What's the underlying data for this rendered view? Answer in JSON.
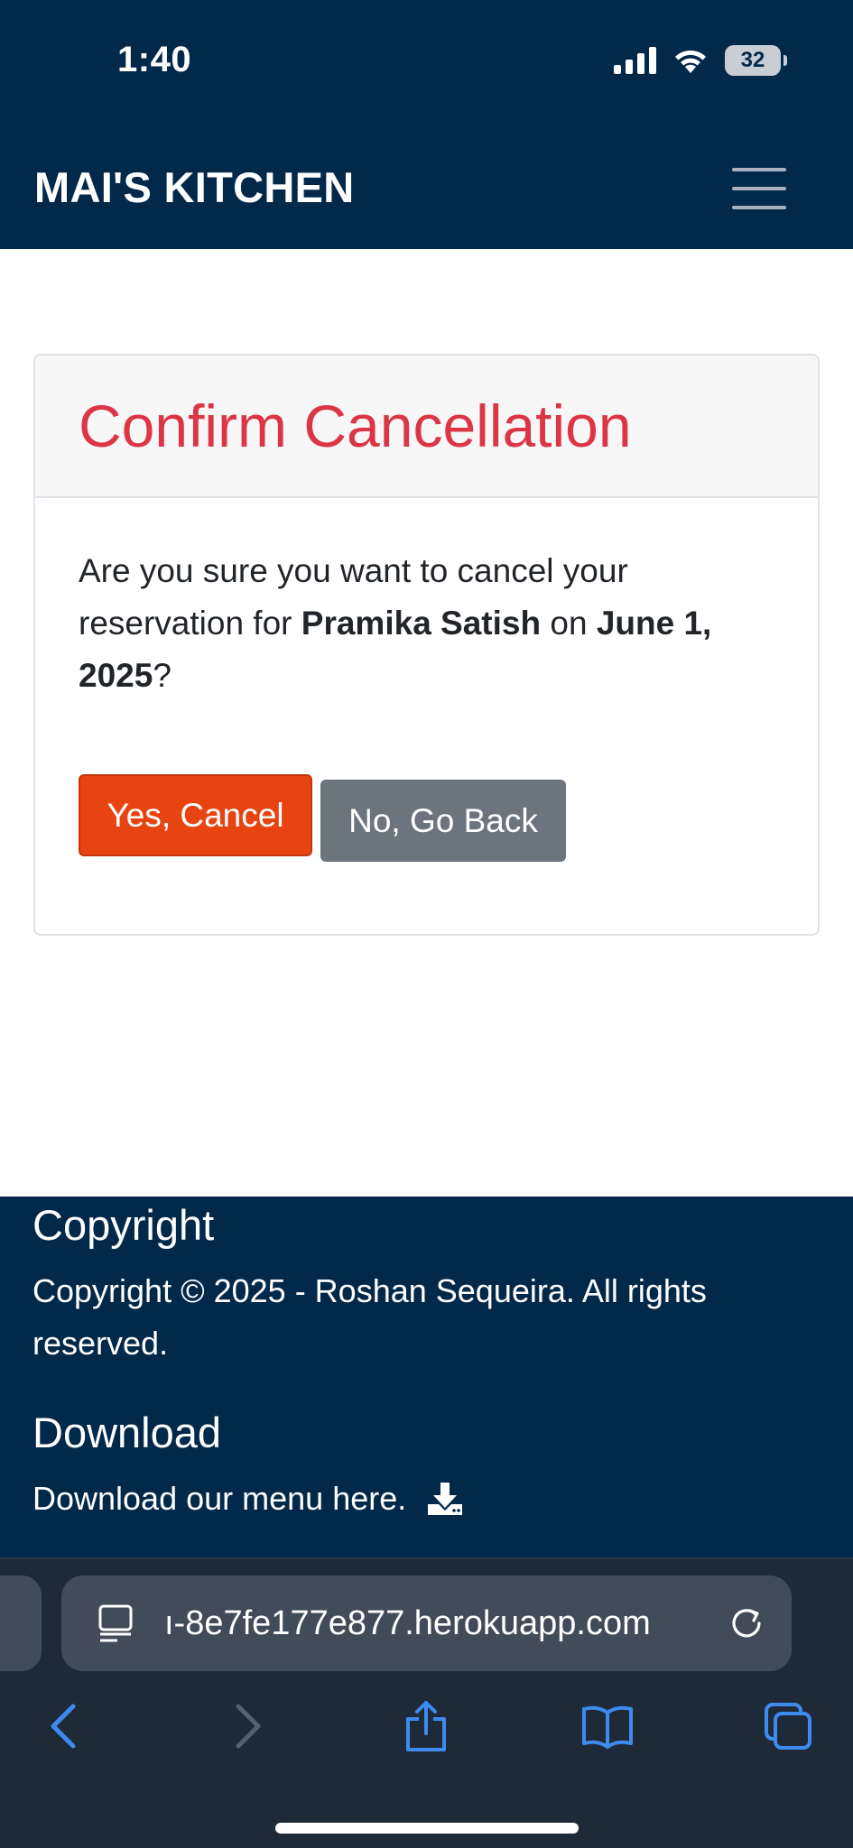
{
  "status_bar": {
    "time": "1:40",
    "battery": "32"
  },
  "navbar": {
    "brand": "MAI'S KITCHEN"
  },
  "card": {
    "title": "Confirm Cancellation",
    "text_before": "Are you sure you want to cancel your reservation for ",
    "name": "Pramika Satish",
    "text_mid": " on ",
    "date": "June 1, 2025",
    "text_after": "?",
    "confirm_label": "Yes, Cancel",
    "back_label": "No, Go Back"
  },
  "footer": {
    "copyright_heading": "Copyright",
    "copyright_text": "Copyright © 2025 - Roshan Sequeira. All rights reserved.",
    "download_heading": "Download",
    "download_text": "Download our menu here."
  },
  "browser": {
    "url": "ı-8e7fe177e877.herokuapp.com"
  },
  "colors": {
    "navy": "#02284a",
    "danger_text": "#dc3545",
    "danger_button": "#e84411",
    "secondary_button": "#6c757d",
    "browser_accent": "#3e8bf0"
  }
}
